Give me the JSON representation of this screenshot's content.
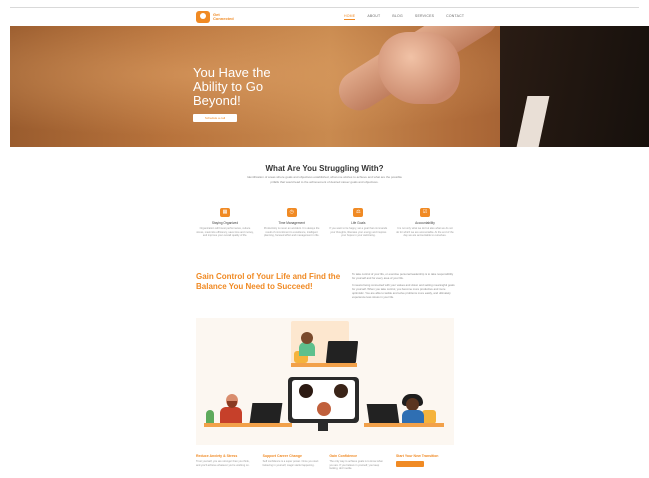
{
  "header": {
    "logo_text": "Get\nConnected",
    "nav": [
      "HOME",
      "ABOUT",
      "BLOG",
      "SERVICES",
      "CONTACT"
    ]
  },
  "hero": {
    "title": "You Have the Ability to Go Beyond!",
    "button_label": "Schedule a call"
  },
  "struggle": {
    "title": "What Are You Struggling With?",
    "text": "Identification of areas where goals and objectives established, what one wishes to achieve and what are the possible pitfalls that would lead to the achievement of desired career goals and objectives.",
    "features": [
      {
        "icon": "calendar-icon",
        "glyph": "▦",
        "title": "Staying Organized",
        "text": "Organization will boost performance, reduce stress, maximize efficiency, save time and money, and improve your overall quality of life."
      },
      {
        "icon": "clock-icon",
        "glyph": "◷",
        "title": "Time Management",
        "text": "Productivity is never an accident. It is always the result of commitment to excellence, intelligent planning, focused effort and management in life."
      },
      {
        "icon": "scale-icon",
        "glyph": "⚖",
        "title": "Life Goals",
        "text": "If you want to be happy, set a goal that commands your thoughts, liberates your energy and inspires your hopes in your well-being."
      },
      {
        "icon": "checklist-icon",
        "glyph": "☑",
        "title": "Accountability",
        "text": "It is not only what we do but also what we do not do for which we are accountable. At the end of the day we are accountable to ourselves."
      }
    ]
  },
  "gain": {
    "title": "Gain Control of Your Life and Find the Balance You Need to Succeed!",
    "paragraphs": [
      "To take control of your life, or exercise personal leadership is to take responsibility for yourself and for every area of your life.",
      "It means being connected with your values and vision and setting meaningful goals for yourself. When you take control, you become more productive and more optimistic. You are able to tackle and solve problems more easily, and ultimately experience less stress in your life."
    ]
  },
  "bottom": [
    {
      "title": "Reduce Anxiety & Stress",
      "text": "Trust yourself, you are stronger than you think, and you'll achieve whatever you're working on."
    },
    {
      "title": "Support Career Change",
      "text": "Self confidence is a super power. Once you start believing in yourself, magic starts happening."
    },
    {
      "title": "Gain Confidence",
      "text": "The only way to achieve goals is to know what you are. If you believe in yourself, you keep looking, don't settle."
    },
    {
      "title": "Start Your New Transition",
      "text": ""
    }
  ],
  "colors": {
    "accent": "#f08a24",
    "text": "#333333",
    "muted": "#999999"
  }
}
